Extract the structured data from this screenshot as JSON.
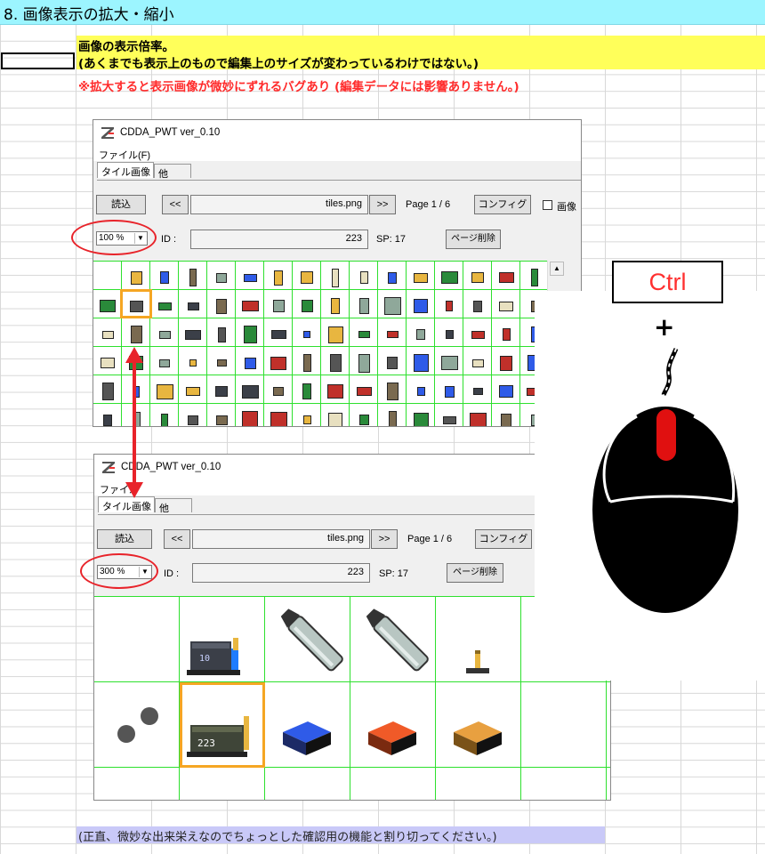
{
  "sheet": {
    "title": "8. 画像表示の拡大・縮小",
    "line1": "画像の表示倍率。",
    "line2": "(あくまでも表示上のもので編集上のサイズが変わっているわけではない。)",
    "line3": "※拡大すると表示画像が微妙にずれるバグあり (編集データには影響ありません。)",
    "footer": "(正直、微妙な出来栄えなのでちょっとした確認用の機能と割り切ってください。)"
  },
  "window_top": {
    "title": "CDDA_PWT ver_0.10",
    "menu_file": "ファイル(F)",
    "tab_tile": "タイル画像",
    "tab_other": "他",
    "load_button": "読込",
    "prev_button": "<<",
    "filename": "tiles.png",
    "next_button": ">>",
    "page": "Page 1 / 6",
    "config_button": "コンフィグ",
    "checkbox_label": "画像",
    "zoom": "100 %",
    "id_label": "ID :",
    "id_value": "223",
    "sp": "SP: 17",
    "delete_page_button": "ページ削除"
  },
  "window_bottom": {
    "title": "CDDA_PWT ver_0.10",
    "menu_file": "ファイル",
    "tab_tile": "タイル画像",
    "tab_other": "他",
    "load_button": "読込",
    "prev_button": "<<",
    "filename": "tiles.png",
    "next_button": ">>",
    "page": "Page 1 / 6",
    "config_button": "コンフィグ",
    "zoom": "300 %",
    "id_label": "ID :",
    "id_value": "223",
    "sp": "SP: 17",
    "delete_page_button": "ページ削除"
  },
  "callout": {
    "key_label": "Ctrl",
    "plus": "+"
  },
  "colors": {
    "header_band": "#9cf5ff",
    "yellow_band": "#ffff5a",
    "warning_red": "#ff2b2b",
    "footer_band": "#c9c9f8",
    "tile_grid": "#2ee02e",
    "highlight_orange": "#f5a623",
    "ellipse_red": "#e8232a"
  }
}
